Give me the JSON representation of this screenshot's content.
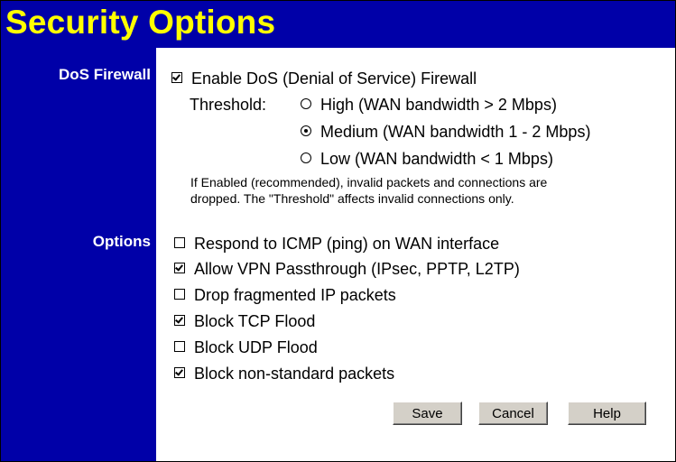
{
  "page": {
    "title": "Security Options"
  },
  "dos_firewall": {
    "section_label": "DoS Firewall",
    "enable_label": "Enable DoS (Denial of Service) Firewall",
    "enable_checked": true,
    "threshold_label": "Threshold:",
    "threshold_options": [
      {
        "label": "High (WAN bandwidth > 2 Mbps)",
        "selected": false
      },
      {
        "label": "Medium (WAN bandwidth 1 - 2 Mbps)",
        "selected": true
      },
      {
        "label": "Low (WAN bandwidth < 1 Mbps)",
        "selected": false
      }
    ],
    "note_line1": "If Enabled (recommended), invalid packets and connections are",
    "note_line2": "dropped. The \"Threshold\" affects invalid connections only."
  },
  "options": {
    "section_label": "Options",
    "items": [
      {
        "label": "Respond to ICMP (ping) on WAN interface",
        "checked": false
      },
      {
        "label": "Allow VPN Passthrough (IPsec, PPTP, L2TP)",
        "checked": true
      },
      {
        "label": "Drop fragmented IP packets",
        "checked": false
      },
      {
        "label": "Block TCP Flood",
        "checked": true
      },
      {
        "label": "Block UDP Flood",
        "checked": false
      },
      {
        "label": "Block non-standard packets",
        "checked": true
      }
    ]
  },
  "buttons": {
    "save": "Save",
    "cancel": "Cancel",
    "help": "Help"
  },
  "colors": {
    "header_bg": "#0000a8",
    "title_text": "#ffff00",
    "label_text": "#ffffff",
    "button_bg": "#d4d0c8"
  }
}
